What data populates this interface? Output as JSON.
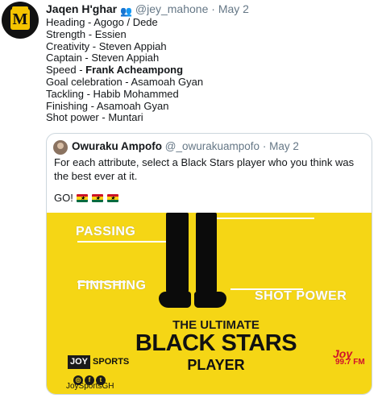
{
  "tweet": {
    "avatar_text": "M",
    "author_name": "Jaqen H'ghar",
    "author_emoji": "👥",
    "handle": "@jey_mahone",
    "separator": "·",
    "date": "May 2",
    "lines": [
      "Heading - Agogo / Dede",
      "Strength - Essien",
      "Creativity - Steven Appiah",
      "Captain - Steven Appiah"
    ],
    "speed_prefix": "Speed - ",
    "speed_value": "Frank Acheampong",
    "lines_after": [
      "Goal celebration - Asamoah Gyan",
      "Tackling - Habib Mohammed",
      "Finishing - Asamoah Gyan",
      "Shot power - Muntari"
    ]
  },
  "quoted": {
    "author_name": "Owuraku Ampofo",
    "handle": "@_owurakuampofo",
    "separator": "·",
    "date": "May 2",
    "text": "For each attribute, select a Black Stars player who you think was the best ever at it.",
    "go_text": "GO!",
    "flag_colors": [
      "#ce1126",
      "#fcd116",
      "#006b3f"
    ]
  },
  "media": {
    "background_color": "#f5d615",
    "label_passing": "PASSING",
    "label_finishing": "FINISHING",
    "label_shot_power": "SHOT POWER",
    "title_line1": "THE ULTIMATE",
    "title_line2": "BLACK STARS",
    "title_line3": "PLAYER",
    "brand_joy": "JOY",
    "brand_sports": "SPORTS",
    "social_handle": "JoySportsGH",
    "radio_logo": "Joy",
    "radio_freq": "99.7 FM"
  }
}
